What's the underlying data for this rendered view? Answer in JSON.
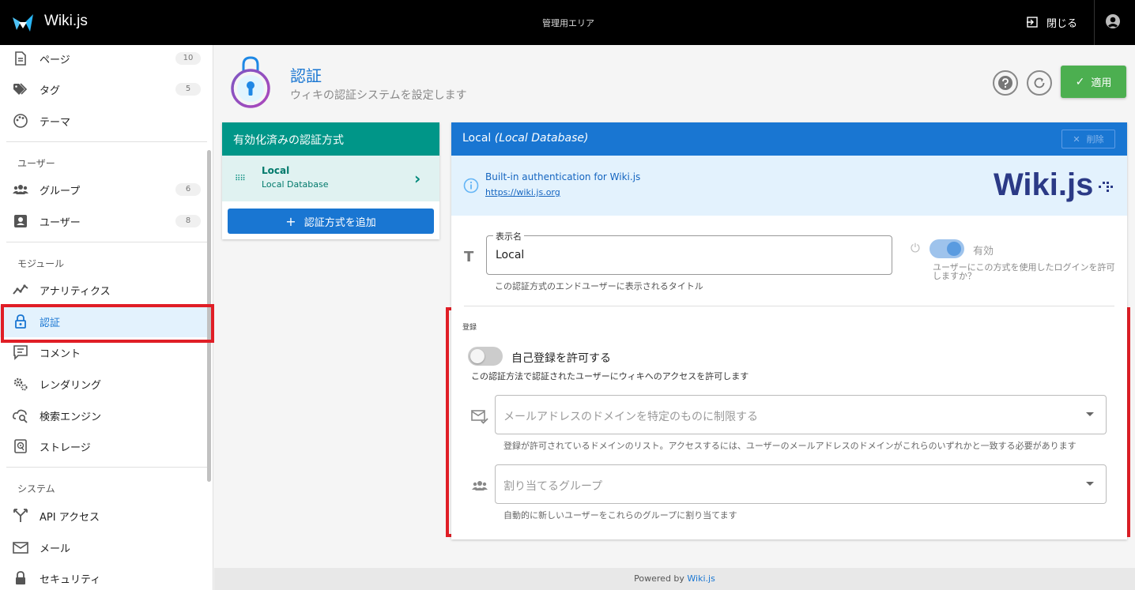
{
  "topbar": {
    "app_title": "Wiki.js",
    "admin_area": "管理用エリア",
    "close_label": "閉じる"
  },
  "sidebar": {
    "items": [
      {
        "label": "ページ",
        "count": "10",
        "icon": "page-icon"
      },
      {
        "label": "タグ",
        "count": "5",
        "icon": "tag-icon"
      },
      {
        "label": "テーマ",
        "icon": "palette-icon"
      },
      {
        "label": "グループ",
        "count": "6",
        "icon": "group-icon"
      },
      {
        "label": "ユーザー",
        "count": "8",
        "icon": "user-icon"
      },
      {
        "label": "アナリティクス",
        "icon": "analytics-icon"
      },
      {
        "label": "認証",
        "icon": "lock-icon",
        "active": true
      },
      {
        "label": "コメント",
        "icon": "comment-icon"
      },
      {
        "label": "レンダリング",
        "icon": "cogs-icon"
      },
      {
        "label": "検索エンジン",
        "icon": "search-cloud-icon"
      },
      {
        "label": "ストレージ",
        "icon": "storage-icon"
      },
      {
        "label": "API アクセス",
        "icon": "api-icon"
      },
      {
        "label": "メール",
        "icon": "mail-icon"
      },
      {
        "label": "セキュリティ",
        "icon": "security-icon"
      }
    ],
    "sections": {
      "users": "ユーザー",
      "modules": "モジュール",
      "system": "システム"
    }
  },
  "header": {
    "title": "認証",
    "subtitle": "ウィキの認証システムを設定します",
    "apply_label": "適用"
  },
  "strategies": {
    "heading": "有効化済みの認証方式",
    "items": [
      {
        "name": "Local",
        "sub": "Local Database"
      }
    ],
    "add_label": "認証方式を追加"
  },
  "detail": {
    "heading_name": "Local",
    "heading_sub": "(Local Database)",
    "delete_label": "削除",
    "info_text": "Built-in authentication for Wiki.js",
    "info_link": "https://wiki.js.org",
    "logo_text": "Wiki.js",
    "display_name_label": "表示名",
    "display_name_value": "Local",
    "display_name_hint": "この認証方式のエンドユーザーに表示されるタイトル",
    "enabled_label": "有効",
    "enabled_hint": "ユーザーにこの方式を使用したログインを許可しますか？",
    "enabled": true,
    "registration_title": "登録",
    "self_reg_label": "自己登録を許可する",
    "self_reg_hint": "この認証方法で認証されたユーザーにウィキへのアクセスを許可します",
    "self_reg_enabled": false,
    "domain_placeholder": "メールアドレスのドメインを特定のものに制限する",
    "domain_hint": "登録が許可されているドメインのリスト。アクセスするには、ユーザーのメールアドレスのドメインがこれらのいずれかと一致する必要があります",
    "groups_placeholder": "割り当てるグループ",
    "groups_hint": "自動的に新しいユーザーをこれらのグループに割り当てます"
  },
  "footer": {
    "prefix": "Powered by",
    "link": "Wiki.js"
  },
  "colors": {
    "topbar": "#000000",
    "primary": "#1976d2",
    "teal": "#009688",
    "apply": "#4caf50",
    "highlight": "#e01e26"
  }
}
